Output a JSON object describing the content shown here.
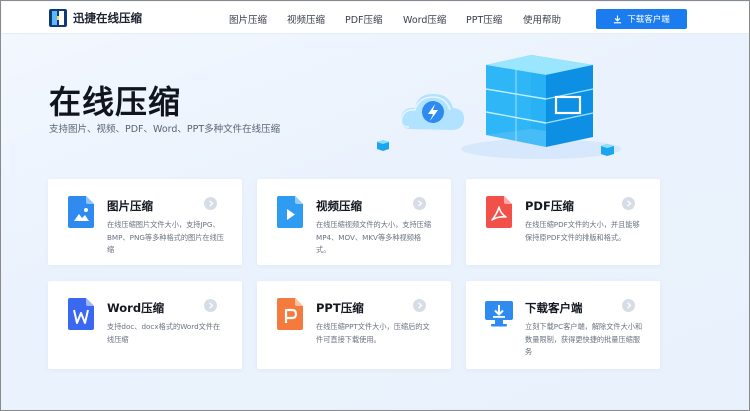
{
  "brand": {
    "name": "迅捷在线压缩"
  },
  "nav": {
    "items": [
      {
        "label": "图片压缩"
      },
      {
        "label": "视频压缩"
      },
      {
        "label": "PDF压缩"
      },
      {
        "label": "Word压缩"
      },
      {
        "label": "PPT压缩"
      },
      {
        "label": "使用帮助"
      }
    ],
    "download_label": "下载客户端"
  },
  "hero": {
    "title": "在线压缩",
    "subtitle": "支持图片、视频、PDF、Word、PPT多种文件在线压缩"
  },
  "cards": [
    {
      "title": "图片压缩",
      "desc": "在线压缩图片文件大小，支持JPG、BMP、PNG等多种格式的图片在线压缩",
      "icon": "image-file-icon",
      "color": "#2f8bf0"
    },
    {
      "title": "视频压缩",
      "desc": "在线压缩视频文件的大小，支持压缩MP4、MOV、MKV等多种视频格式。",
      "icon": "video-file-icon",
      "color": "#2f9cf2"
    },
    {
      "title": "PDF压缩",
      "desc": "在线压缩PDF文件的大小，并且能够保持原PDF文件的排版和格式。",
      "icon": "pdf-file-icon",
      "color": "#f2514a"
    },
    {
      "title": "Word压缩",
      "desc": "支持doc、docx格式的Word文件在线压缩",
      "icon": "word-file-icon",
      "color": "#3a68f0"
    },
    {
      "title": "PPT压缩",
      "desc": "在线压缩PPT文件大小，压缩后的文件可直接下载使用。",
      "icon": "ppt-file-icon",
      "color": "#f47a3d"
    },
    {
      "title": "下载客户端",
      "desc": "立刻下载PC客户端，解除文件大小和数量限制，获得更快捷的批量压缩服务",
      "icon": "download-monitor-icon",
      "color": "#2f8bf0"
    }
  ],
  "colors": {
    "accent": "#1b7cf0"
  }
}
